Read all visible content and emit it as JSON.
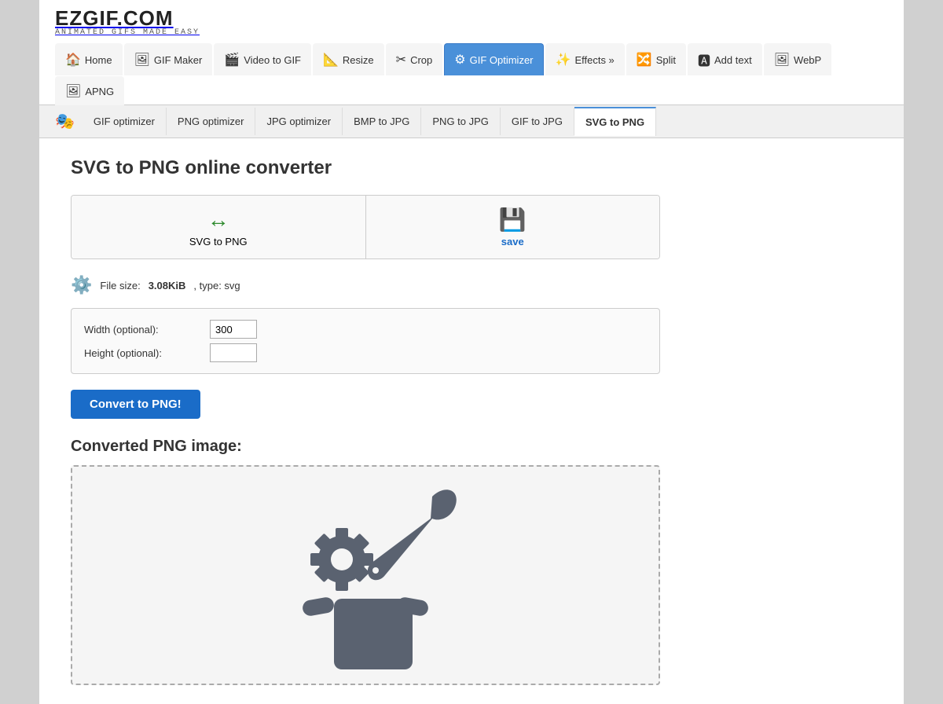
{
  "logo": {
    "main": "EZGIF.COM",
    "sub": "ANIMATED GIFS MADE EASY"
  },
  "nav": {
    "items": [
      {
        "id": "home",
        "label": "Home",
        "icon": "🏠",
        "active": false
      },
      {
        "id": "gif-maker",
        "label": "GIF Maker",
        "icon": "🖼",
        "active": false
      },
      {
        "id": "video-to-gif",
        "label": "Video to GIF",
        "icon": "🎬",
        "active": false
      },
      {
        "id": "resize",
        "label": "Resize",
        "icon": "📐",
        "active": false
      },
      {
        "id": "crop",
        "label": "Crop",
        "icon": "✂",
        "active": false
      },
      {
        "id": "gif-optimizer",
        "label": "GIF Optimizer",
        "icon": "⚙",
        "active": true
      },
      {
        "id": "effects",
        "label": "Effects »",
        "icon": "✨",
        "active": false
      },
      {
        "id": "split",
        "label": "Split",
        "icon": "🔀",
        "active": false
      },
      {
        "id": "add-text",
        "label": "Add text",
        "icon": "🅰",
        "active": false
      },
      {
        "id": "webp",
        "label": "WebP",
        "icon": "🖼",
        "active": false
      },
      {
        "id": "apng",
        "label": "APNG",
        "icon": "🖼",
        "active": false
      }
    ]
  },
  "subnav": {
    "items": [
      {
        "id": "gif-optimizer",
        "label": "GIF optimizer",
        "active": false
      },
      {
        "id": "png-optimizer",
        "label": "PNG optimizer",
        "active": false
      },
      {
        "id": "jpg-optimizer",
        "label": "JPG optimizer",
        "active": false
      },
      {
        "id": "bmp-to-jpg",
        "label": "BMP to JPG",
        "active": false
      },
      {
        "id": "png-to-jpg",
        "label": "PNG to JPG",
        "active": false
      },
      {
        "id": "gif-to-jpg",
        "label": "GIF to JPG",
        "active": false
      },
      {
        "id": "svg-to-png",
        "label": "SVG to PNG",
        "active": true
      }
    ]
  },
  "page": {
    "title": "SVG to PNG online converter",
    "upload_label": "SVG to PNG",
    "save_label": "save",
    "file_size_label": "File size: ",
    "file_size_value": "3.08KiB",
    "file_type_label": ", type: svg",
    "width_label": "Width (optional):",
    "height_label": "Height (optional):",
    "width_value": "300",
    "height_value": "",
    "convert_btn": "Convert to PNG!",
    "converted_label": "Converted PNG image:"
  },
  "colors": {
    "accent": "#1a6cc8",
    "nav_active_bg": "#4a90d9",
    "icon_gray": "#5a6270"
  }
}
